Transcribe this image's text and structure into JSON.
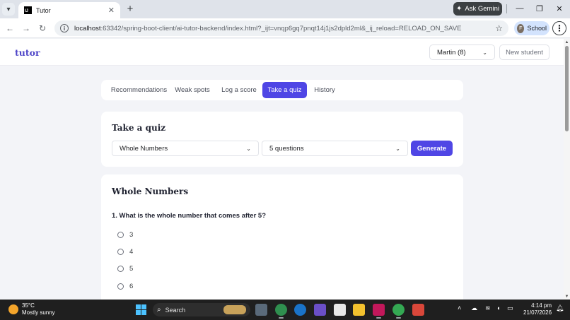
{
  "browser": {
    "tab_title": "Tutor",
    "tab_favicon_text": "IJ",
    "gemini_label": "Ask Gemini",
    "url_host": "localhost",
    "url_rest": ":63342/spring-boot-client/ai-tutor-backend/index.html?_ijt=vnqp6gq7pnqt14j1js2dpld2ml&_ij_reload=RELOAD_ON_SAVE",
    "profile_initial": "F",
    "profile_label": "School"
  },
  "app": {
    "logo": "tutor",
    "student_select": "Martin (8)",
    "new_student_label": "New student"
  },
  "nav_tabs": [
    {
      "label": "Recommendations",
      "active": false
    },
    {
      "label": "Weak spots",
      "active": false
    },
    {
      "label": "Log a score",
      "active": false
    },
    {
      "label": "Take a quiz",
      "active": true
    },
    {
      "label": "History",
      "active": false
    }
  ],
  "quiz_setup": {
    "title": "Take a quiz",
    "topic_value": "Whole Numbers",
    "count_value": "5 questions",
    "generate_label": "Generate"
  },
  "quiz": {
    "topic_title": "Whole Numbers",
    "question_1": "1. What is the whole number that comes after 5?",
    "options": [
      "3",
      "4",
      "5",
      "6"
    ]
  },
  "taskbar": {
    "temperature": "35°C",
    "weather": "Mostly sunny",
    "search_label": "Search",
    "time": "4:14 pm",
    "date": "21/07/2026"
  },
  "colors": {
    "accent": "#4f46e5",
    "logo": "#4f46c8"
  }
}
